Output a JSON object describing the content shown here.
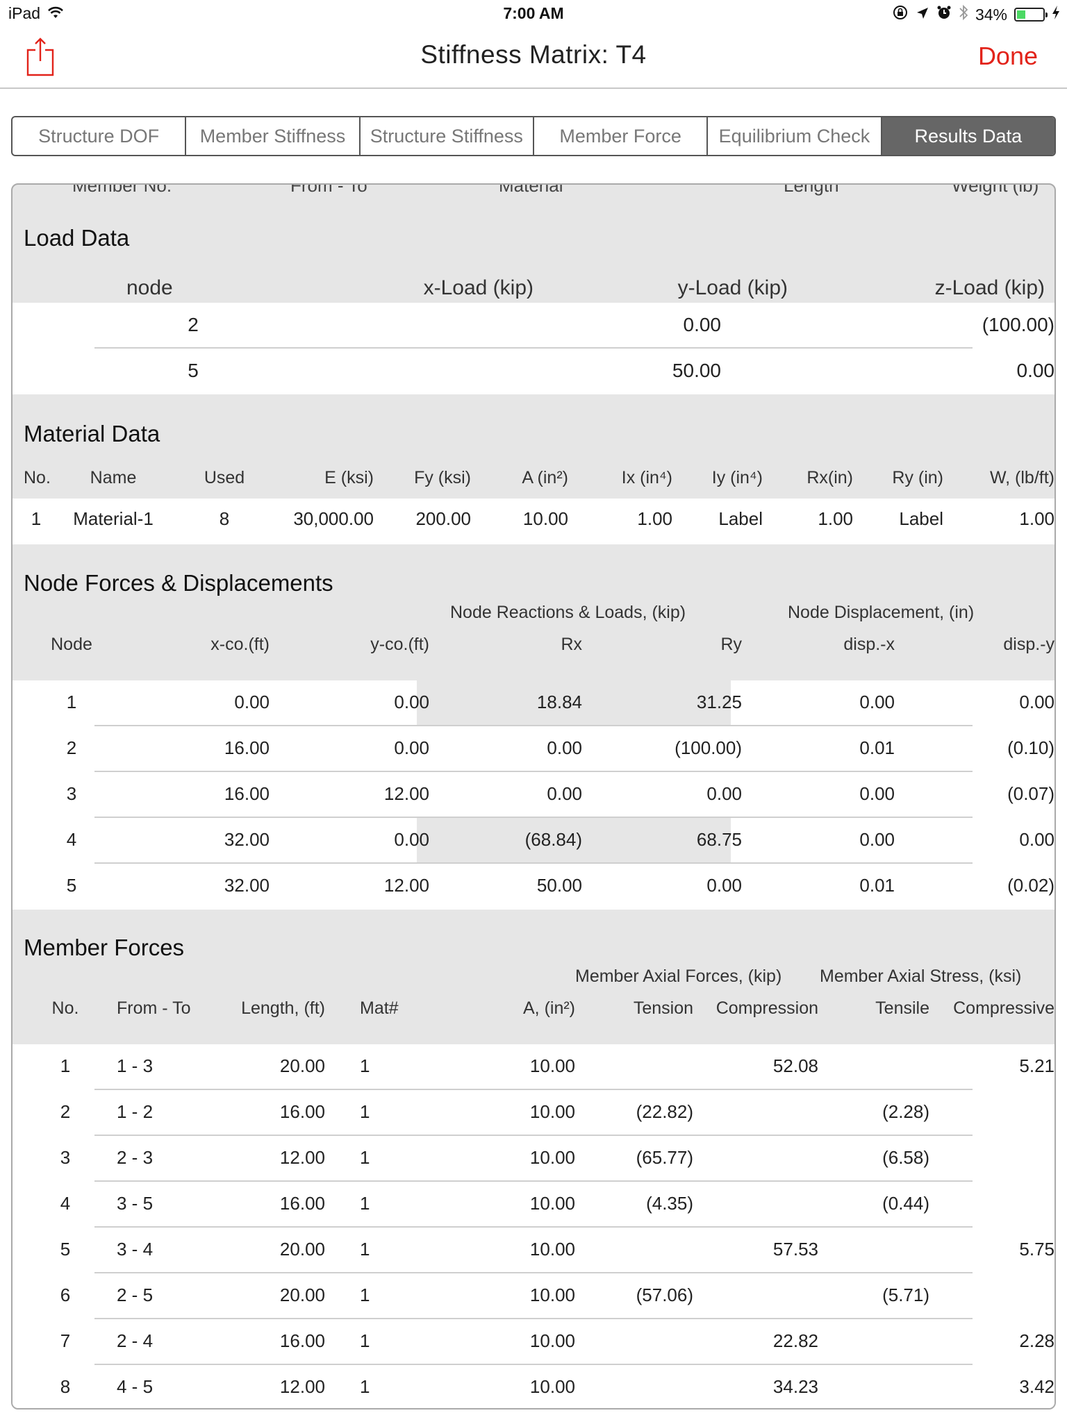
{
  "status_bar": {
    "device": "iPad",
    "time": "7:00 AM",
    "battery_percent": "34%",
    "battery_level": 0.34,
    "icons": [
      "wifi-icon",
      "rotation-lock-icon",
      "location-icon",
      "alarm-icon",
      "bluetooth-icon",
      "battery-icon",
      "charging-icon"
    ]
  },
  "nav": {
    "title": "Stiffness Matrix: T4",
    "done_label": "Done",
    "accent_color": "#e2231a"
  },
  "tabs": [
    {
      "label": "Structure DOF",
      "active": false
    },
    {
      "label": "Member Stiffness",
      "active": false
    },
    {
      "label": "Structure Stiffness",
      "active": false
    },
    {
      "label": "Member Force",
      "active": false
    },
    {
      "label": "Equilibrium Check",
      "active": false
    },
    {
      "label": "Results Data",
      "active": true
    }
  ],
  "cut_off_header": [
    "Member No.",
    "From - To",
    "Material",
    "Length",
    "Weight (lb)"
  ],
  "load_data": {
    "title": "Load Data",
    "headers": [
      "node",
      "x-Load (kip)",
      "y-Load (kip)",
      "z-Load (kip)"
    ],
    "rows": [
      {
        "node": "2",
        "x_load": "",
        "y_load": "0.00",
        "z_load": "(100.00)"
      },
      {
        "node": "5",
        "x_load": "",
        "y_load": "50.00",
        "z_load": "0.00"
      }
    ]
  },
  "material_data": {
    "title": "Material Data",
    "headers": [
      "No.",
      "Name",
      "Used",
      "E (ksi)",
      "Fy (ksi)",
      "A (in²)",
      "Ix (in⁴)",
      "Iy (in⁴)",
      "Rx(in)",
      "Ry (in)",
      "W, (lb/ft)"
    ],
    "rows": [
      [
        "1",
        "Material-1",
        "8",
        "30,000.00",
        "200.00",
        "10.00",
        "1.00",
        "Label",
        "1.00",
        "Label",
        "1.00"
      ]
    ]
  },
  "node_forces": {
    "title": "Node Forces & Displacements",
    "group_headers": {
      "reactions": "Node Reactions & Loads, (kip)",
      "displacement": "Node Displacement, (in)"
    },
    "headers": [
      "Node",
      "x-co.(ft)",
      "y-co.(ft)",
      "Rx",
      "Ry",
      "disp.-x",
      "disp.-y"
    ],
    "rows": [
      {
        "cells": [
          "1",
          "0.00",
          "0.00",
          "18.84",
          "31.25",
          "0.00",
          "0.00"
        ],
        "support": true
      },
      {
        "cells": [
          "2",
          "16.00",
          "0.00",
          "0.00",
          "(100.00)",
          "0.01",
          "(0.10)"
        ],
        "support": false
      },
      {
        "cells": [
          "3",
          "16.00",
          "12.00",
          "0.00",
          "0.00",
          "0.00",
          "(0.07)"
        ],
        "support": false
      },
      {
        "cells": [
          "4",
          "32.00",
          "0.00",
          "(68.84)",
          "68.75",
          "0.00",
          "0.00"
        ],
        "support": true
      },
      {
        "cells": [
          "5",
          "32.00",
          "12.00",
          "50.00",
          "0.00",
          "0.01",
          "(0.02)"
        ],
        "support": false
      }
    ]
  },
  "member_forces": {
    "title": "Member Forces",
    "group_headers": {
      "forces": "Member Axial Forces, (kip)",
      "stress": "Member Axial Stress, (ksi)"
    },
    "headers": [
      "No.",
      "From - To",
      "Length, (ft)",
      "Mat#",
      "A, (in²)",
      "Tension",
      "Compression",
      "Tensile",
      "Compressive"
    ],
    "rows": [
      [
        "1",
        "1 - 3",
        "20.00",
        "1",
        "10.00",
        "",
        "52.08",
        "",
        "5.21"
      ],
      [
        "2",
        "1 - 2",
        "16.00",
        "1",
        "10.00",
        "(22.82)",
        "",
        "(2.28)",
        ""
      ],
      [
        "3",
        "2 - 3",
        "12.00",
        "1",
        "10.00",
        "(65.77)",
        "",
        "(6.58)",
        ""
      ],
      [
        "4",
        "3 - 5",
        "16.00",
        "1",
        "10.00",
        "(4.35)",
        "",
        "(0.44)",
        ""
      ],
      [
        "5",
        "3 - 4",
        "20.00",
        "1",
        "10.00",
        "",
        "57.53",
        "",
        "5.75"
      ],
      [
        "6",
        "2 - 5",
        "20.00",
        "1",
        "10.00",
        "(57.06)",
        "",
        "(5.71)",
        ""
      ],
      [
        "7",
        "2 - 4",
        "16.00",
        "1",
        "10.00",
        "",
        "22.82",
        "",
        "2.28"
      ],
      [
        "8",
        "4 - 5",
        "12.00",
        "1",
        "10.00",
        "",
        "34.23",
        "",
        "3.42"
      ]
    ]
  }
}
